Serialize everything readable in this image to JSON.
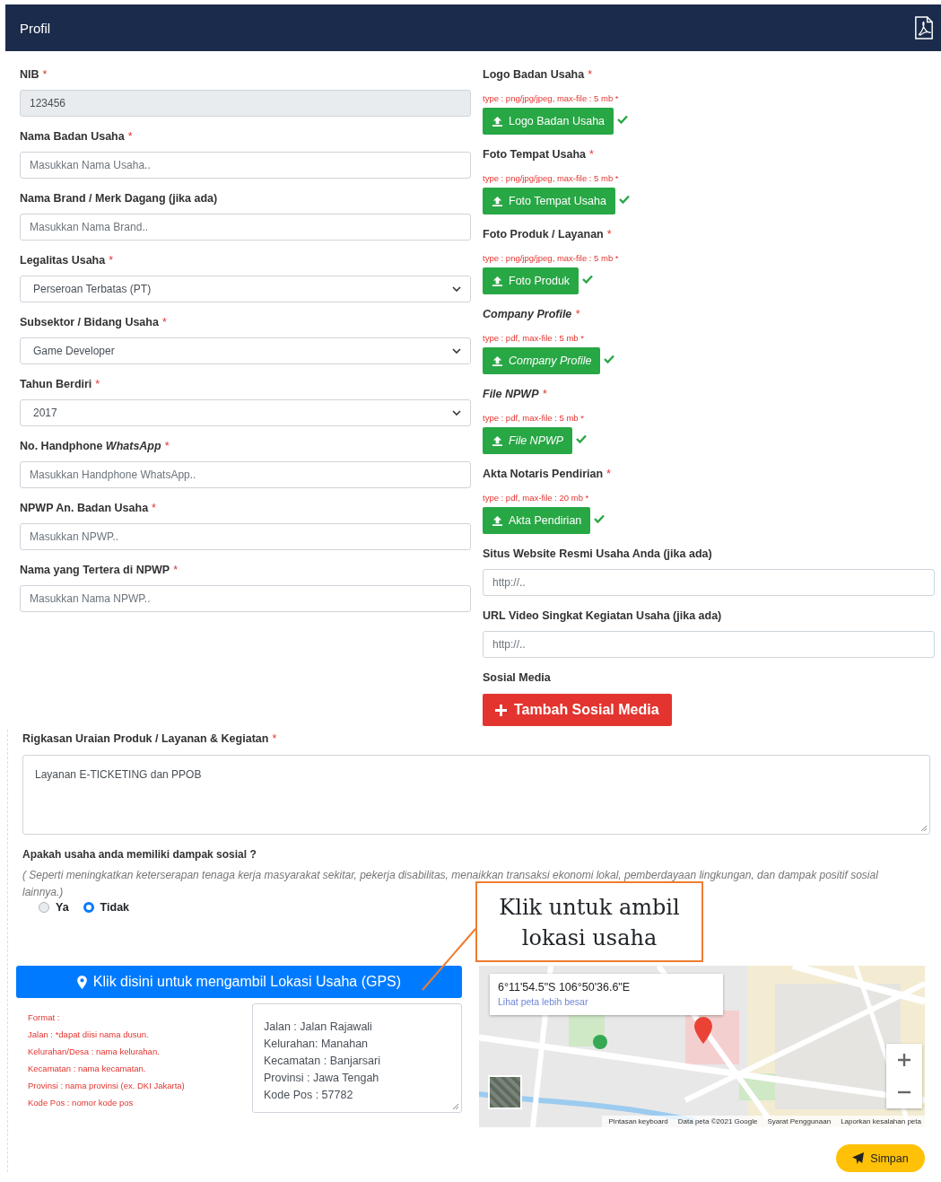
{
  "header": {
    "title": "Profil"
  },
  "left_fields": [
    {
      "kind": "input",
      "label": "NIB",
      "mark": "*",
      "value": "123456",
      "disabled": true
    },
    {
      "kind": "input",
      "label": "Nama Badan Usaha",
      "mark": "*",
      "placeholder": "Masukkan Nama Usaha.."
    },
    {
      "kind": "input",
      "label": "Nama Brand / Merk Dagang (jika ada)",
      "placeholder": "Masukkan Nama Brand.."
    },
    {
      "kind": "select",
      "label": "Legalitas Usaha",
      "mark": "*",
      "value": "Perseroan Terbatas (PT)"
    },
    {
      "kind": "select",
      "label": "Subsektor / Bidang Usaha",
      "mark": "*",
      "value": "Game Developer"
    },
    {
      "kind": "select",
      "label": "Tahun Berdiri",
      "mark": "*",
      "value": "2017"
    },
    {
      "kind": "input",
      "label": "No. Handphone *WhatsApp*",
      "mark": "*",
      "placeholder": "Masukkan Handphone WhatsApp.."
    },
    {
      "kind": "input",
      "label": "NPWP An. Badan Usaha",
      "mark": "*",
      "placeholder": "Masukkan NPWP.."
    },
    {
      "kind": "input",
      "label": "Nama yang Tertera di NPWP",
      "mark": "*",
      "placeholder": "Masukkan Nama NPWP.."
    }
  ],
  "uploads": [
    {
      "label": "Logo Badan Usaha",
      "mark": "*",
      "hint": "type : png/jpg/jpeg, max-file : 5 mb *",
      "button": "Logo Badan Usaha",
      "italic": false,
      "uploaded": true
    },
    {
      "label": "Foto Tempat Usaha",
      "mark": "*",
      "hint": "type : png/jpg/jpeg, max-file : 5 mb *",
      "button": "Foto Tempat Usaha",
      "italic": false,
      "uploaded": true
    },
    {
      "label": "Foto Produk / Layanan",
      "mark": "*",
      "hint": "type : png/jpg/jpeg, max-file : 5 mb *",
      "button": "Foto Produk",
      "italic": false,
      "uploaded": true
    },
    {
      "label": "Company Profile",
      "mark": "*",
      "hint": "type : pdf, max-file : 5 mb *",
      "button": "Company Profile",
      "italic": true,
      "uploaded": true
    },
    {
      "label": "File NPWP",
      "mark": "*",
      "hint": "type : pdf, max-file : 5 mb *",
      "button": "File NPWP",
      "italic": true,
      "uploaded": true
    },
    {
      "label": "Akta Notaris Pendirian",
      "mark": "*",
      "hint": "type : pdf, max-file : 20 mb *",
      "button": "Akta Pendirian",
      "italic": false,
      "uploaded": true
    }
  ],
  "right_fields": [
    {
      "label": "Situs Website Resmi Usaha Anda (jika ada)",
      "placeholder": "http://.."
    },
    {
      "label": "URL Video Singkat Kegiatan Usaha (jika ada)",
      "placeholder": "http://.."
    }
  ],
  "social": {
    "label": "Sosial Media",
    "button": "Tambah Sosial Media"
  },
  "summary": {
    "label": "Rigkasan Uraian Produk / Layanan & Kegiatan",
    "mark": "*",
    "value": "Layanan E-TICKETING dan PPOB"
  },
  "impact": {
    "question": "Apakah usaha anda memiliki dampak sosial ?",
    "note": "( Seperti meningkatkan keterserapan tenaga kerja masyarakat sekitar, pekerja disabilitas, menaikkan transaksi ekonomi lokal, pemberdayaan lingkungan, dan dampak positif sosial lainnya.)",
    "options": [
      {
        "label": "Ya",
        "selected": false
      },
      {
        "label": "Tidak",
        "selected": true
      }
    ]
  },
  "callout": {
    "text": "Klik untuk ambil lokasi usaha"
  },
  "gps_button": "Klik disini untuk mengambil Lokasi Usaha (GPS)",
  "format_lines": [
    "Format :",
    "Jalan : *dapat diisi nama dusun.",
    "Kelurahan/Desa : nama kelurahan.",
    "Kecamatan : nama kecamatan.",
    "Provinsi : nama provinsi (ex. DKI Jakarta)",
    "Kode Pos : nomor kode pos"
  ],
  "address": {
    "value": "Jalan : Jalan Rajawali\nKelurahan: Manahan\nKecamatan : Banjarsari\nProvinsi : Jawa Tengah\nKode Pos : 57782"
  },
  "map": {
    "coordinates": "6°11'54.5\"S 106°50'36.6\"E",
    "link": "Lihat peta lebih besar",
    "footer": [
      "Pintasan keyboard",
      "Data peta ©2021 Google",
      "Syarat Penggunaan",
      "Laporkan kesalahan peta"
    ]
  },
  "save_button": "Simpan"
}
